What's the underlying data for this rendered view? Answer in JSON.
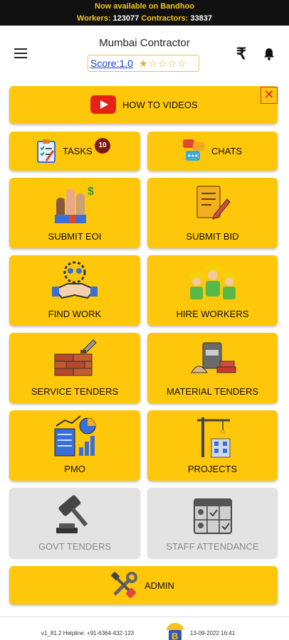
{
  "banner": {
    "line1": "Now available on Bandhoo",
    "workers_label": "Workers:",
    "workers_count": "123077",
    "contractors_label": "Contractors:",
    "contractors_count": "33837"
  },
  "header": {
    "title": "Mumbai Contractor",
    "score": "Score:1.0",
    "stars": "★☆☆☆☆",
    "rupee_icon": "rupee-icon",
    "bell_icon": "bell-icon"
  },
  "tiles": {
    "how_to_videos": "HOW TO VIDEOS",
    "tasks": "TASKS",
    "tasks_badge": "10",
    "chats": "CHATS",
    "submit_eoi": "SUBMIT EOI",
    "submit_bid": "SUBMIT BID",
    "find_work": "FIND WORK",
    "hire_workers": "HIRE WORKERS",
    "service_tenders": "SERVICE TENDERS",
    "material_tenders": "MATERIAL TENDERS",
    "pmo": "PMO",
    "projects": "PROJECTS",
    "govt_tenders": "GOVT TENDERS",
    "staff_attendance": "STAFF ATTENDANCE",
    "admin": "ADMIN"
  },
  "footer": {
    "version": "v1_81.2 Helpline: +91-6364-432-123",
    "date": "13-09-2022 16:41"
  },
  "colors": {
    "tile": "#fec70a",
    "disabled_tile": "#e3e3e3",
    "banner_bg": "#111111",
    "banner_text": "#f5c518",
    "badge": "#7a1b12"
  }
}
